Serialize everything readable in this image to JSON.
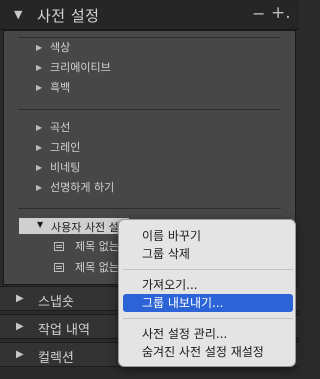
{
  "panel": {
    "title": "사전 설정",
    "minus_label": "−",
    "plus_label": "+."
  },
  "folders_group1": [
    "색상",
    "크리에이티브",
    "흑백"
  ],
  "folders_group2": [
    "곡선",
    "그레인",
    "비네팅",
    "선명하게 하기"
  ],
  "user_folder": {
    "label": "사용자 사전 설정",
    "presets": [
      "제목 없는 사전 설정",
      "제목 없는 사전 설정"
    ]
  },
  "collapsed_panels": [
    "스냅숏",
    "작업 내역",
    "컬렉션"
  ],
  "context_menu": {
    "items": [
      {
        "label": "이름 바꾸기"
      },
      {
        "label": "그룹 삭제"
      },
      {
        "label": "가져오기..."
      },
      {
        "label": "그룹 내보내기...",
        "selected": true
      },
      {
        "label": "사전 설정 관리..."
      },
      {
        "label": "숨겨진 사전 설정 재설정"
      }
    ]
  },
  "colors": {
    "menu_highlight": "#2c63d6",
    "panel_bg": "#474747"
  }
}
